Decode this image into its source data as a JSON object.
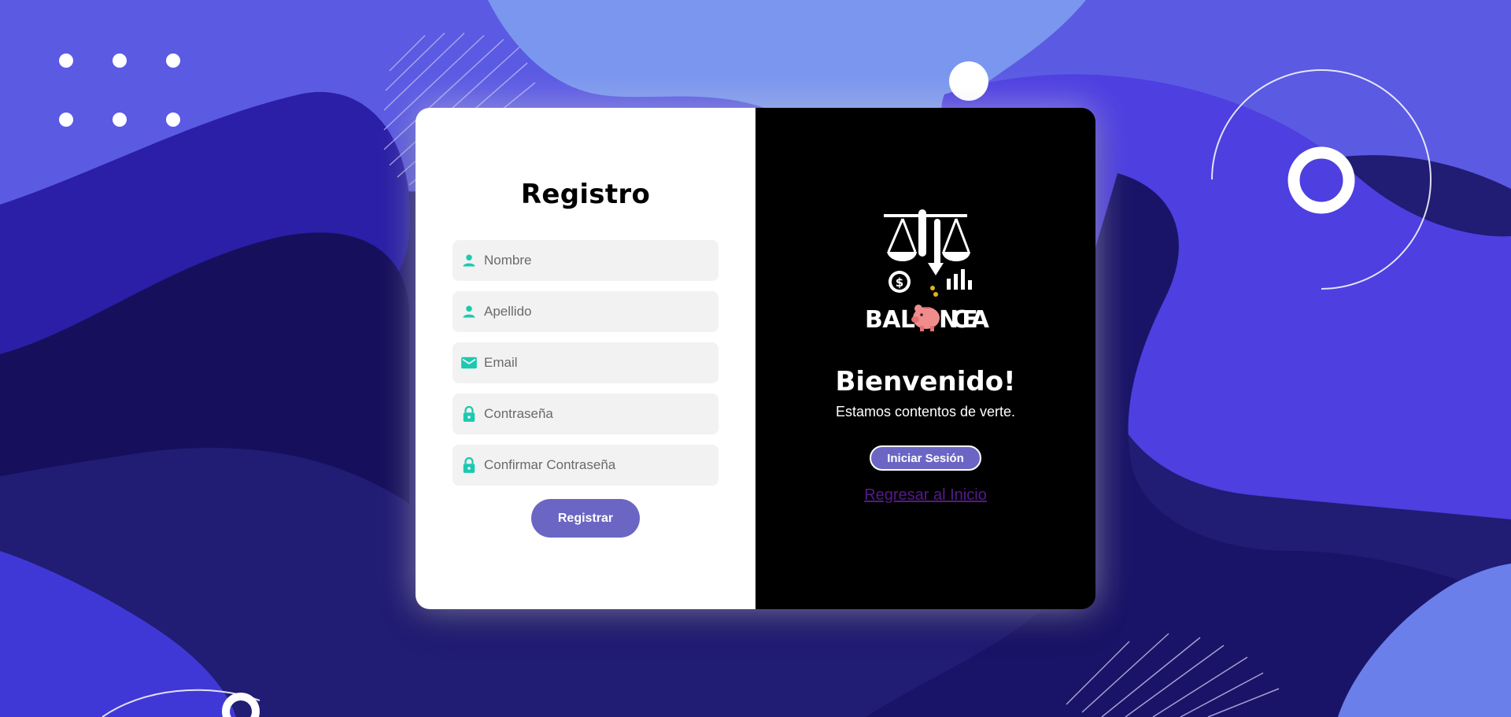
{
  "colors": {
    "page_background": "#1f1b6e",
    "accent_button": "#6b66c4",
    "icon_teal": "#1cc9b0",
    "link_visited": "#551a8b"
  },
  "register_form": {
    "title": "Registro",
    "fields": [
      {
        "name": "nombre",
        "placeholder": "Nombre",
        "icon": "person-icon",
        "type": "text",
        "value": ""
      },
      {
        "name": "apellido",
        "placeholder": "Apellido",
        "icon": "person-icon",
        "type": "text",
        "value": ""
      },
      {
        "name": "email",
        "placeholder": "Email",
        "icon": "envelope-icon",
        "type": "email",
        "value": ""
      },
      {
        "name": "contrasena",
        "placeholder": "Contraseña",
        "icon": "lock-icon",
        "type": "password",
        "value": ""
      },
      {
        "name": "confirmar",
        "placeholder": "Confirmar Contraseña",
        "icon": "lock-icon",
        "type": "password",
        "value": ""
      }
    ],
    "submit_label": "Registrar"
  },
  "welcome_panel": {
    "logo_text": "BALANCEA",
    "title": "Bienvenido!",
    "subtitle": "Estamos contentos de verte.",
    "login_button": "Iniciar Sesión",
    "home_link": "Regresar al Inicio"
  }
}
